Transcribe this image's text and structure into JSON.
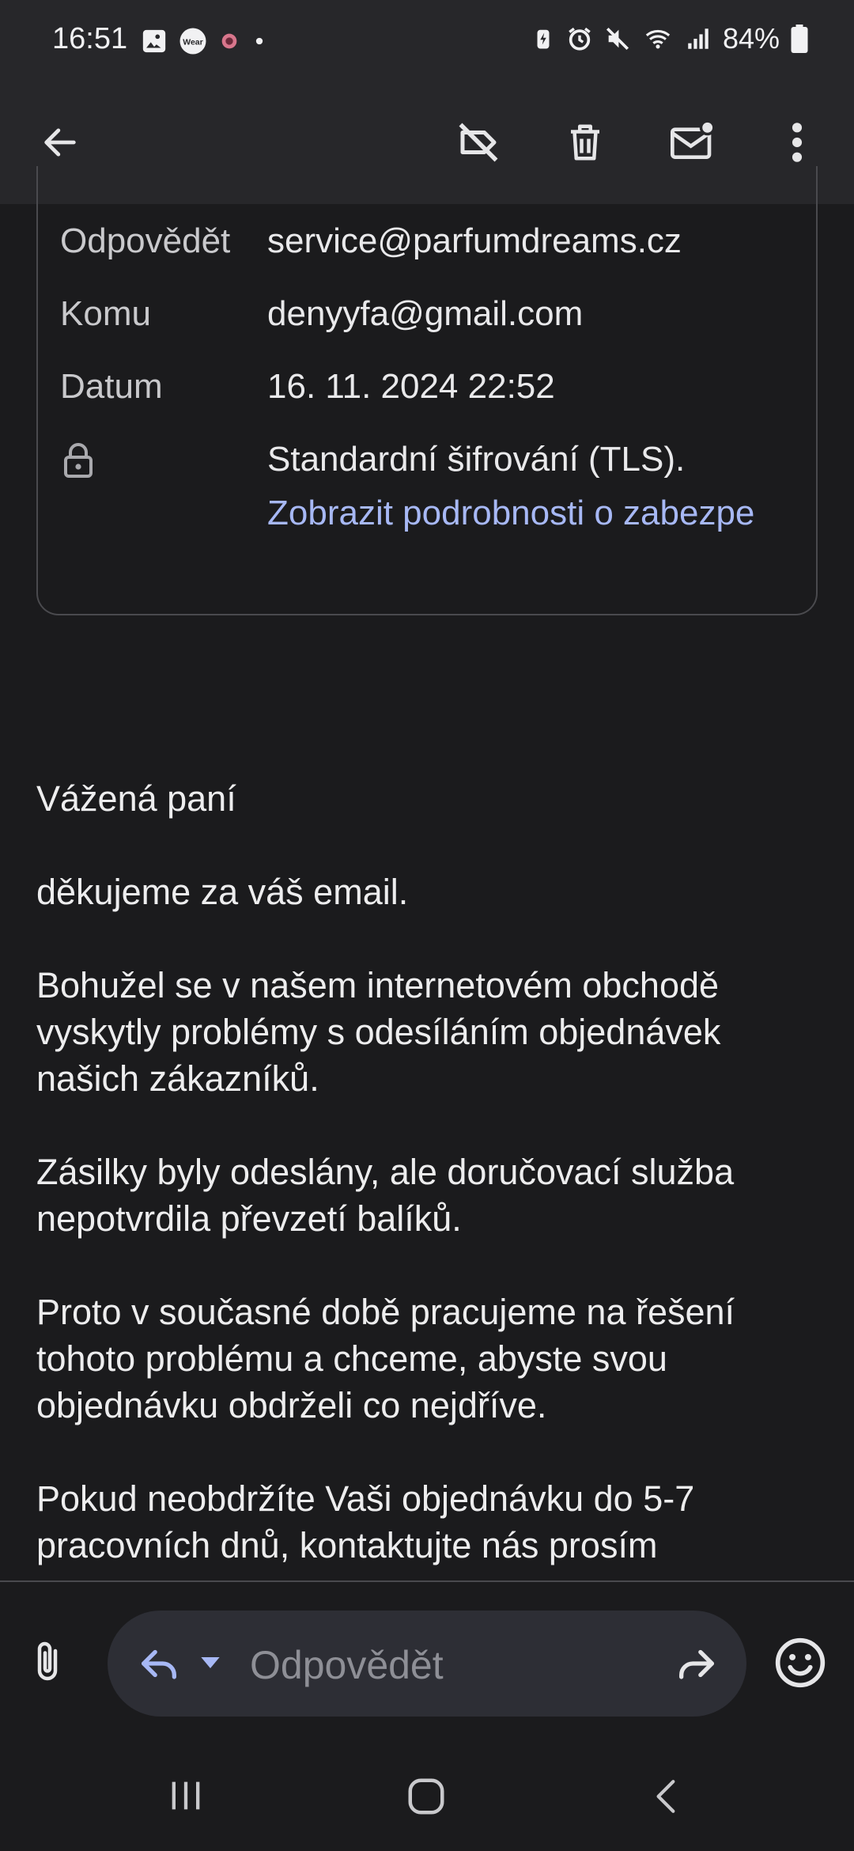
{
  "status_bar": {
    "time": "16:51",
    "battery": "84%",
    "left_icons": [
      "image-icon",
      "wear-icon",
      "app-icon",
      "dot-icon"
    ],
    "right_icons": [
      "battery-saver-icon",
      "alarm-icon",
      "mute-icon",
      "wifi-icon",
      "signal-icon",
      "battery-icon"
    ]
  },
  "toolbar": {
    "icons": [
      "back-arrow-icon",
      "label-off-icon",
      "delete-icon",
      "mark-unread-icon",
      "more-vert-icon"
    ]
  },
  "details": {
    "reply_label": "Odpovědět",
    "reply_value": "service@parfumdreams.cz",
    "to_label": "Komu",
    "to_value": "denyyfa@gmail.com",
    "date_label": "Datum",
    "date_value": "16. 11. 2024 22:52",
    "security_value": "Standardní šifrování (TLS).",
    "security_link": "Zobrazit podrobnosti o zabezpe"
  },
  "body": {
    "greeting": "Vážená paní",
    "p1": "děkujeme za váš email.",
    "p2_l1": "Bohužel se v našem internetovém obchodě",
    "p2_l2": "vyskytly problémy s odesíláním objednávek",
    "p2_l3": "našich zákazníků.",
    "p3_l1": "Zásilky byly odeslány, ale doručovací služba",
    "p3_l2": "nepotvrdila převzetí balíků.",
    "p4_l1": "Proto v současné době pracujeme na řešení",
    "p4_l2": "tohoto problému a chceme, abyste svou",
    "p4_l3": "objednávku obdrželi co nejdříve.",
    "p5_l1": "Pokud neobdržíte Vaši objednávku do 5-7",
    "p5_l2": "pracovních dnů, kontaktujte nás prosím"
  },
  "compose": {
    "placeholder": "Odpovědět"
  },
  "colors": {
    "background": "#1b1b1d",
    "appbar": "#27272a",
    "link": "#a7b8f5",
    "pill": "#2d2e35"
  }
}
